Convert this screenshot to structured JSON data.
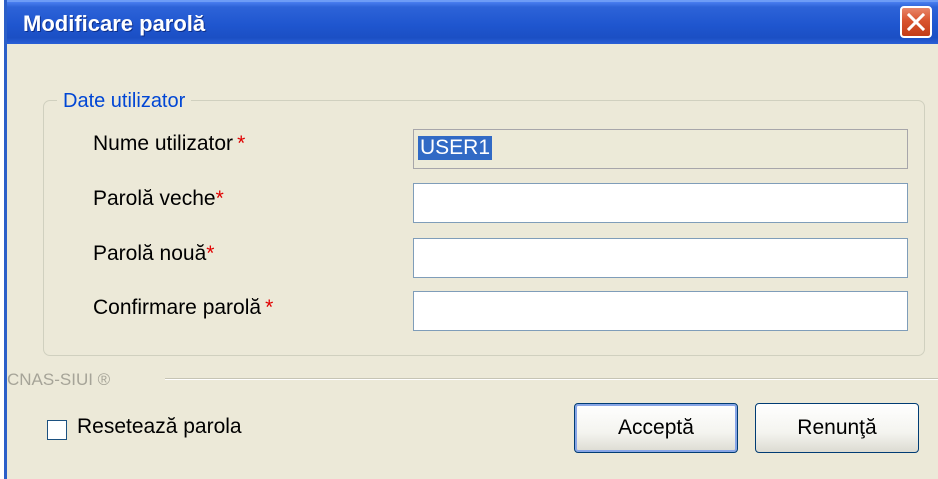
{
  "window": {
    "title": "Modificare parolă"
  },
  "user_group": {
    "legend": "Date utilizator",
    "fields": [
      {
        "label": "Nume utilizator",
        "required_mark": "*",
        "value": "USER1",
        "readonly": true
      },
      {
        "label": "Parolă veche",
        "required_mark": "*",
        "value": ""
      },
      {
        "label": "Parolă nouă",
        "required_mark": "*",
        "value": ""
      },
      {
        "label": "Confirmare parolă",
        "required_mark": "*",
        "value": ""
      }
    ]
  },
  "footer": {
    "brand": "CNAS-SIUI ®",
    "reset_label": "Resetează parola",
    "reset_checked": false,
    "accept_label": "Acceptă",
    "cancel_label": "Renunţă"
  },
  "colors": {
    "titlebar": "#1f56cf",
    "legend": "#0046d5",
    "required": "#e00000",
    "selection": "#316ac5"
  },
  "icons": {
    "close": "close-icon"
  }
}
